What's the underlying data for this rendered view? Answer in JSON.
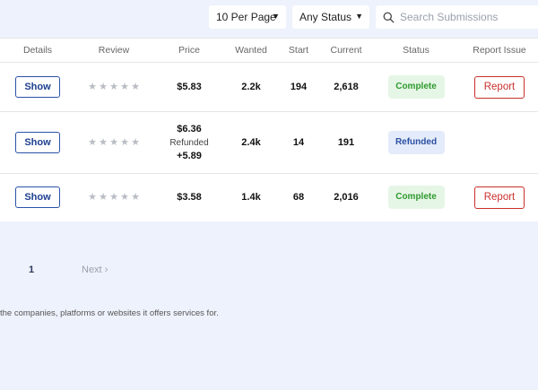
{
  "toolbar": {
    "per_page": "10 Per Page",
    "status": "Any Status",
    "search_placeholder": "Search Submissions"
  },
  "table": {
    "headers": [
      "Details",
      "Review",
      "Price",
      "Wanted",
      "Start",
      "Current",
      "Status",
      "Report Issue"
    ],
    "rows": [
      {
        "details": "Show",
        "rating": 0,
        "price": "$5.83",
        "price_note": "",
        "price_extra": "",
        "wanted": "2.2k",
        "start": "194",
        "current": "2,618",
        "status": "Complete",
        "report": "Report"
      },
      {
        "details": "Show",
        "rating": 0,
        "price": "$6.36",
        "price_note": "Refunded",
        "price_extra": "+5.89",
        "wanted": "2.4k",
        "start": "14",
        "current": "191",
        "status": "Refunded",
        "report": ""
      },
      {
        "details": "Show",
        "rating": 0,
        "price": "$3.58",
        "price_note": "",
        "price_extra": "",
        "wanted": "1.4k",
        "start": "68",
        "current": "2,016",
        "status": "Complete",
        "report": "Report"
      }
    ]
  },
  "pagination": {
    "current": "1",
    "next": "Next"
  },
  "footer": {
    "note": "the companies, platforms or websites it offers services for."
  },
  "colors": {
    "accent": "#1d3f8f",
    "complete": "#2f9a2f",
    "refunded": "#2a4fa3",
    "report": "#c9302c"
  },
  "icons": {
    "search": "search-icon",
    "dropdown": "caret-down-icon",
    "star": "star-icon",
    "next": "chevron-right-icon"
  }
}
